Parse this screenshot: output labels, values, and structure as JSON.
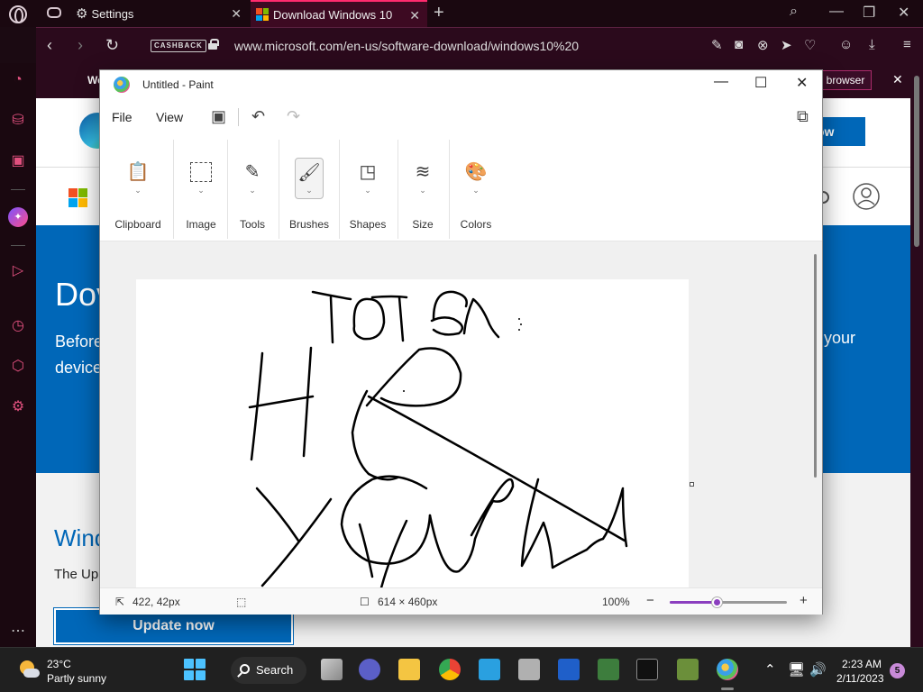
{
  "browser": {
    "tabs": [
      {
        "label": "Settings"
      },
      {
        "label": "Download Windows 10"
      }
    ],
    "cashback": "CASHBACK",
    "url": "www.microsoft.com/en-us/software-download/windows10%20"
  },
  "webpage": {
    "banner_text": "We",
    "banner_button": "browser",
    "edge_button": "ow",
    "hero_title": "Dov",
    "hero_sub": "Before device",
    "hero_right": "your",
    "section_title": "Wind",
    "section_text": "The Up",
    "update_button": "Update now"
  },
  "paint": {
    "title": "Untitled - Paint",
    "menu": {
      "file": "File",
      "view": "View"
    },
    "groups": [
      {
        "label": "Clipboard"
      },
      {
        "label": "Image"
      },
      {
        "label": "Tools"
      },
      {
        "label": "Brushes"
      },
      {
        "label": "Shapes"
      },
      {
        "label": "Size"
      },
      {
        "label": "Colors"
      }
    ],
    "status": {
      "cursor": "422, 42px",
      "canvas_size": "614 × 460px",
      "zoom": "100%",
      "zoom_level": 0.4
    }
  },
  "taskbar": {
    "temperature": "23°C",
    "weather": "Partly sunny",
    "search": "Search",
    "time": "2:23 AM",
    "date": "2/11/2023",
    "notifications": "5"
  },
  "colors": {
    "opera_accent": "#ff2b6e",
    "ms_blue": "#0067b8",
    "paint_accent": "#8b3fbf"
  }
}
